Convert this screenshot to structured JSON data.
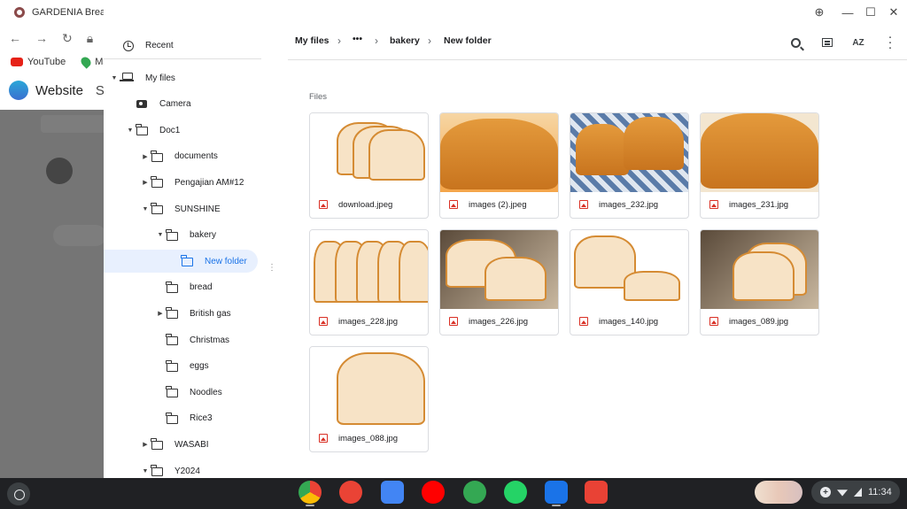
{
  "browser": {
    "tab_title": "GARDENIA Breads",
    "bookmarks": [
      "YouTube",
      "Ma"
    ],
    "site_title": "Website",
    "site_nav_fragment": "Si"
  },
  "sidebar": {
    "recent": "Recent",
    "tree": [
      {
        "label": "My files",
        "depth": 0,
        "arrow": "expanded",
        "icon": "laptop-icon"
      },
      {
        "label": "Camera",
        "depth": 1,
        "arrow": "none",
        "icon": "camera-icon"
      },
      {
        "label": "Doc1",
        "depth": 1,
        "arrow": "expanded",
        "icon": "folder-icon"
      },
      {
        "label": "documents",
        "depth": 2,
        "arrow": "collapsed",
        "icon": "folder-icon"
      },
      {
        "label": "Pengajian AM#12",
        "depth": 2,
        "arrow": "collapsed",
        "icon": "folder-icon"
      },
      {
        "label": "SUNSHINE",
        "depth": 2,
        "arrow": "expanded",
        "icon": "folder-icon"
      },
      {
        "label": "bakery",
        "depth": 3,
        "arrow": "expanded",
        "icon": "folder-icon"
      },
      {
        "label": "New folder",
        "depth": 4,
        "arrow": "none",
        "icon": "folder-icon",
        "selected": true
      },
      {
        "label": "bread",
        "depth": 3,
        "arrow": "none",
        "icon": "folder-icon"
      },
      {
        "label": "British gas",
        "depth": 3,
        "arrow": "collapsed",
        "icon": "folder-icon"
      },
      {
        "label": "Christmas",
        "depth": 3,
        "arrow": "none",
        "icon": "folder-icon"
      },
      {
        "label": "eggs",
        "depth": 3,
        "arrow": "none",
        "icon": "folder-icon"
      },
      {
        "label": "Noodles",
        "depth": 3,
        "arrow": "none",
        "icon": "folder-icon"
      },
      {
        "label": "Rice3",
        "depth": 3,
        "arrow": "none",
        "icon": "folder-icon"
      },
      {
        "label": "WASABI",
        "depth": 2,
        "arrow": "collapsed",
        "icon": "folder-icon"
      },
      {
        "label": "Y2024",
        "depth": 2,
        "arrow": "expanded",
        "icon": "folder-icon"
      }
    ]
  },
  "toolbar": {
    "breadcrumbs": [
      "My files",
      "•••",
      "bakery",
      "New folder"
    ],
    "icons": [
      "search-icon",
      "grid-view-icon",
      "sort-icon",
      "more-vert-icon"
    ],
    "sort_label": "AZ"
  },
  "main": {
    "section_label": "Files",
    "files": [
      {
        "name": "download.jpeg",
        "art": "slices-white"
      },
      {
        "name": "images (2).jpeg",
        "art": "sliced-loaf-orange"
      },
      {
        "name": "images_232.jpg",
        "art": "loaves-check"
      },
      {
        "name": "images_231.jpg",
        "art": "glazed-orange"
      },
      {
        "name": "images_228.jpg",
        "art": "slices-row"
      },
      {
        "name": "images_226.jpg",
        "art": "board-dark"
      },
      {
        "name": "images_140.jpg",
        "art": "loaf-fan"
      },
      {
        "name": "images_089.jpg",
        "art": "slices-dark"
      },
      {
        "name": "images_088.jpg",
        "art": "loaf-front"
      }
    ]
  },
  "window_controls": [
    "zoom-icon",
    "minimize-icon",
    "maximize-icon",
    "close-icon"
  ],
  "shelf": {
    "apps": [
      {
        "name": "chrome-icon",
        "color": "#4285f4"
      },
      {
        "name": "gmail-icon",
        "color": "#ea4335"
      },
      {
        "name": "docs-icon",
        "color": "#4285f4"
      },
      {
        "name": "youtube-icon",
        "color": "#ff0000"
      },
      {
        "name": "play-store-icon",
        "color": "#34a853"
      },
      {
        "name": "whatsapp-business-icon",
        "color": "#25d366"
      },
      {
        "name": "files-icon",
        "color": "#1a73e8"
      },
      {
        "name": "screen-capture-icon",
        "color": "#e94235"
      }
    ],
    "time": "11:34"
  }
}
